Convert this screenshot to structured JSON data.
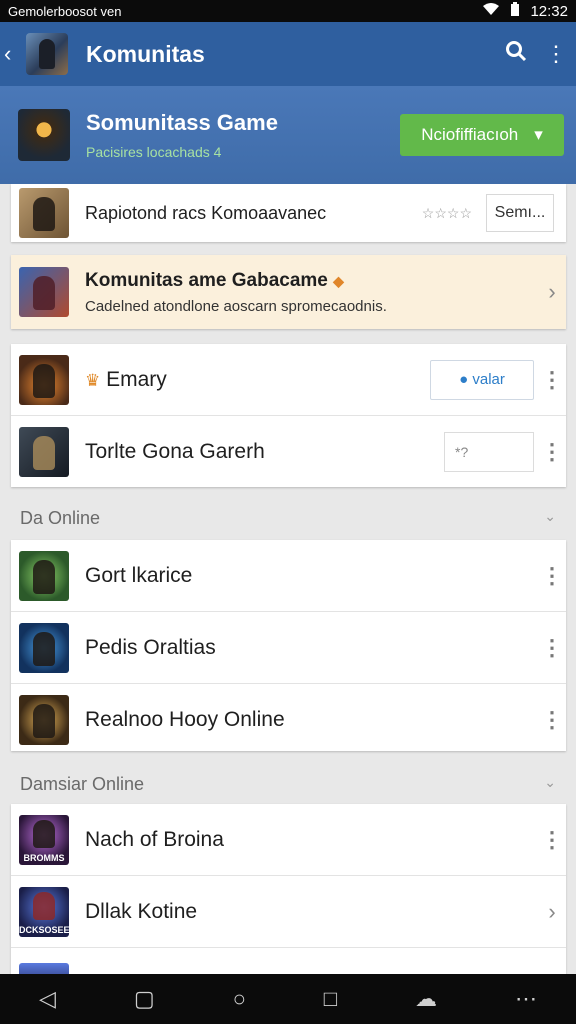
{
  "status_bar": {
    "left_text": "Gemolerboosot  ven",
    "time": "12:32"
  },
  "toolbar": {
    "title": "Komunitas",
    "back_label": "‹",
    "search_label": "🔍",
    "more_label": "⋮"
  },
  "game": {
    "title": "Somunitass Game",
    "subtitle": "Pacisires locachads 4",
    "notify_label": "Nciofiffiacıoh",
    "notify_arrow": "▾"
  },
  "cards": {
    "top_row": {
      "label": "Rapiotond racs Komoaavanec",
      "stars": "☆☆☆☆",
      "action": "Semı..."
    },
    "featured": {
      "title": "Komunitas ame Gabacame",
      "description": "Cadelned atondlone aoscarn spromecaodnis.",
      "badge": "◆",
      "chevron": "›"
    },
    "group1": [
      {
        "label": "Emary",
        "prefix": "♛",
        "action": "● valar",
        "menu": "⋮"
      },
      {
        "label": "Torlte Gona Garerh",
        "action": "*?",
        "menu": "⋮"
      }
    ]
  },
  "section1": {
    "title": "Da Online",
    "arrow": "⌄"
  },
  "group2": [
    {
      "label": "Gort lkarice",
      "menu": "⋮"
    },
    {
      "label": "Pedis Oraltias",
      "menu": "⋮"
    },
    {
      "label": "Realnoo Hooy Online",
      "menu": "⋮"
    }
  ],
  "section2": {
    "title": "Damsiar Online",
    "arrow": "⌄"
  },
  "group3": [
    {
      "label": "Nach of Broina",
      "caption": "BROMMS",
      "menu": "⋮"
    },
    {
      "label": "Dllak Kotine",
      "caption": "DCKSOSEE",
      "menu": "›"
    }
  ],
  "nav": {
    "back": "◁",
    "square": "▢",
    "home": "○",
    "recents": "□",
    "cloud": "☁",
    "more": "⋯"
  },
  "colors": {
    "toolbar": "#2f5f9f",
    "header": "#3f6ca9",
    "notify": "#62b94a",
    "featured_bg": "#fbf0dc",
    "subtitle": "#a7e1a2"
  }
}
